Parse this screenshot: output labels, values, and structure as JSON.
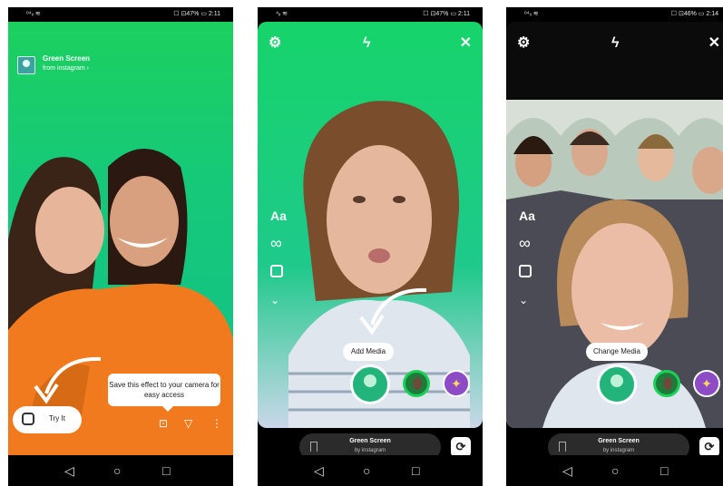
{
  "phones": [
    {
      "status": {
        "left": "ᵒ⁴ᵢᵢ ≋",
        "right": "☐ ⊡47% ▭ 2:11"
      },
      "header": {
        "title": "Green Screen",
        "subtitle": "from instagram ›"
      },
      "try_button": "Try It",
      "tooltip": "Save this effect to your camera for easy access"
    },
    {
      "status": {
        "left": "⁴ᵢᵢ ≋",
        "right": "☐ ⊡47% ▭ 2:11"
      },
      "side_text": "Aa",
      "pill": "Add Media",
      "effect": {
        "name": "Green Screen",
        "by": "by instagram"
      }
    },
    {
      "status": {
        "left": "ᵒ⁴ᵢᵢ ≋",
        "right": "☐ ⊡46% ▭ 2:14"
      },
      "side_text": "Aa",
      "pill": "Change Media",
      "effect": {
        "name": "Green Screen",
        "by": "by instagram"
      }
    }
  ],
  "colors": {
    "green_screen": "#16cf74",
    "highlight": "#1bd058"
  },
  "icons": [
    "settings-icon",
    "flash-off-icon",
    "close-icon",
    "infinity-icon",
    "layout-icon",
    "chevron-down-icon",
    "flip-camera-icon",
    "bookmark-icon",
    "send-icon"
  ]
}
